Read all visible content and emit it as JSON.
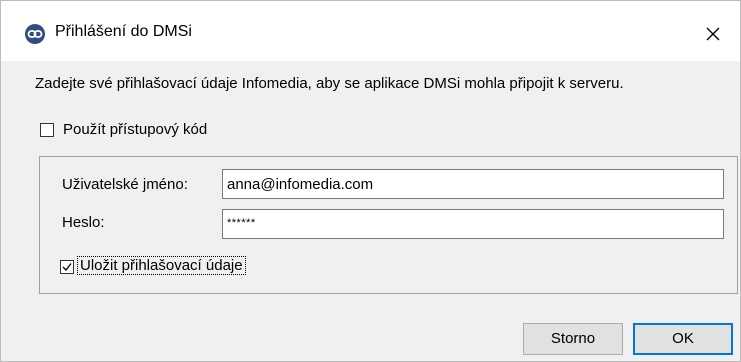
{
  "window": {
    "title": "Přihlášení do DMSi",
    "app_icon": "chain-link-icon",
    "close_icon": "close-icon"
  },
  "instruction": "Zadejte své přihlašovací údaje Infomedia, aby se aplikace DMSi mohla připojit k serveru.",
  "access_code": {
    "label": "Použít přístupový kód",
    "checked": false
  },
  "credentials": {
    "username_label": "Uživatelské jméno:",
    "username_value": "anna@infomedia.com",
    "password_label": "Heslo:",
    "password_value": "******",
    "save_label": "Uložit přihlašovací údaje",
    "save_checked": true
  },
  "buttons": {
    "cancel": "Storno",
    "ok": "OK"
  },
  "colors": {
    "icon_bg": "#2f4d80",
    "default_button_border": "#0078d7",
    "dialog_bg": "#f0f0f0"
  }
}
